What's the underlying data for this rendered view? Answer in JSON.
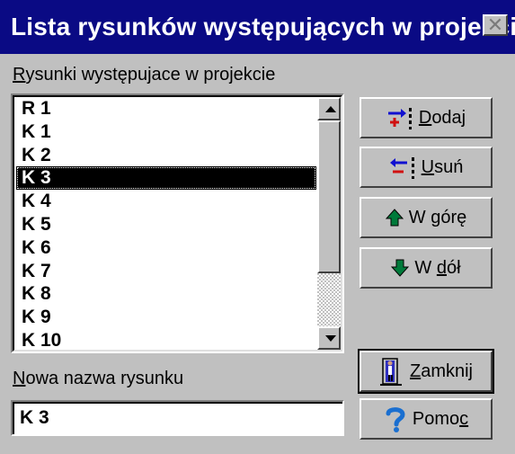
{
  "window": {
    "title": "Lista rysunków występujących w projekcie",
    "close_glyph": "✕"
  },
  "list": {
    "label": "ysunki występujace w projekcie",
    "label_accel": "R",
    "items": [
      "R 1",
      "K 1",
      "K 2",
      "K 3",
      "K 4",
      "K 5",
      "K 6",
      "K 7",
      "K 8",
      "K 9",
      "K 10"
    ],
    "selected_index": 3
  },
  "buttons": {
    "add": {
      "accel": "D",
      "rest": "odaj",
      "icon": "add-drawing-icon"
    },
    "remove": {
      "accel": "U",
      "rest": "suń",
      "icon": "remove-drawing-icon"
    },
    "up": {
      "pre": "W ",
      "accel": "g",
      "rest": "órę",
      "icon": "arrow-up-icon"
    },
    "down": {
      "pre": "W ",
      "accel": "d",
      "rest": "ół",
      "icon": "arrow-down-icon"
    },
    "close": {
      "accel": "Z",
      "rest": "amknij",
      "icon": "exit-door-icon"
    },
    "help": {
      "pre": "Pomo",
      "accel": "c",
      "rest": "",
      "icon": "question-mark-icon"
    }
  },
  "name_field": {
    "label_accel": "N",
    "label": "owa nazwa rysunku",
    "value": "K 3"
  },
  "colors": {
    "title_bar": "#0a0a84",
    "face": "#c0c0c0",
    "selection": "#000000"
  }
}
